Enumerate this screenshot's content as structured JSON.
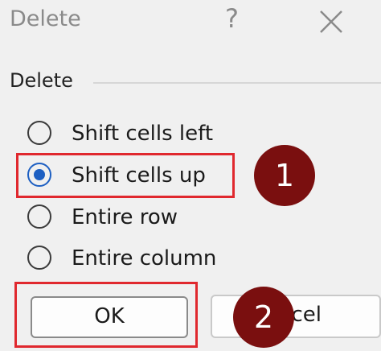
{
  "dialog": {
    "title": "Delete",
    "help_label": "?",
    "group_label": "Delete"
  },
  "options": [
    {
      "label": "Shift cells left",
      "checked": false
    },
    {
      "label": "Shift cells up",
      "checked": true
    },
    {
      "label": "Entire row",
      "checked": false
    },
    {
      "label": "Entire column",
      "checked": false
    }
  ],
  "buttons": {
    "ok_label": "OK",
    "cancel_label_visible": "cel"
  },
  "annotations": {
    "step1_label": "1",
    "step2_label": "2",
    "highlight_color": "#e0282e",
    "marker_color": "#7a0f0f"
  },
  "colors": {
    "radio_selected": "#1d5fc2",
    "background": "#f0f0f0"
  }
}
